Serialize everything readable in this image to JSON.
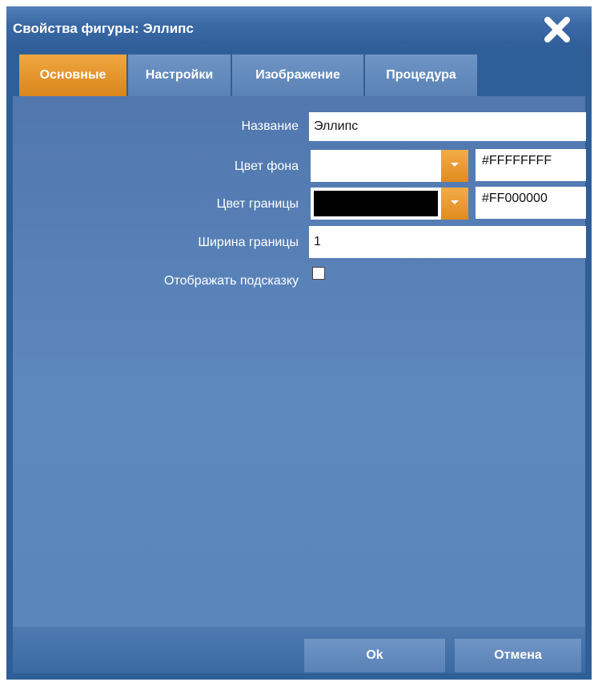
{
  "window": {
    "title": "Свойства фигуры: Эллипс",
    "close_icon": "close-icon"
  },
  "tabs": [
    {
      "label": "Основные",
      "active": true
    },
    {
      "label": "Настройки",
      "active": false
    },
    {
      "label": "Изображение",
      "active": false
    },
    {
      "label": "Процедура",
      "active": false
    }
  ],
  "form": {
    "name": {
      "label": "Название",
      "value": "Эллипс"
    },
    "bg_color": {
      "label": "Цвет фона",
      "swatch": "#FFFFFF",
      "hex": "#FFFFFFFF"
    },
    "border_color": {
      "label": "Цвет границы",
      "swatch": "#000000",
      "hex": "#FF000000"
    },
    "border_width": {
      "label": "Ширина границы",
      "value": "1"
    },
    "show_hint": {
      "label": "Отображать подсказку",
      "checked": false
    }
  },
  "buttons": {
    "ok": "Ok",
    "cancel": "Отмена"
  },
  "colors": {
    "accent": "#E8971F",
    "window_bg": "#2F5F98",
    "panel_bg": "#5A86BC"
  }
}
